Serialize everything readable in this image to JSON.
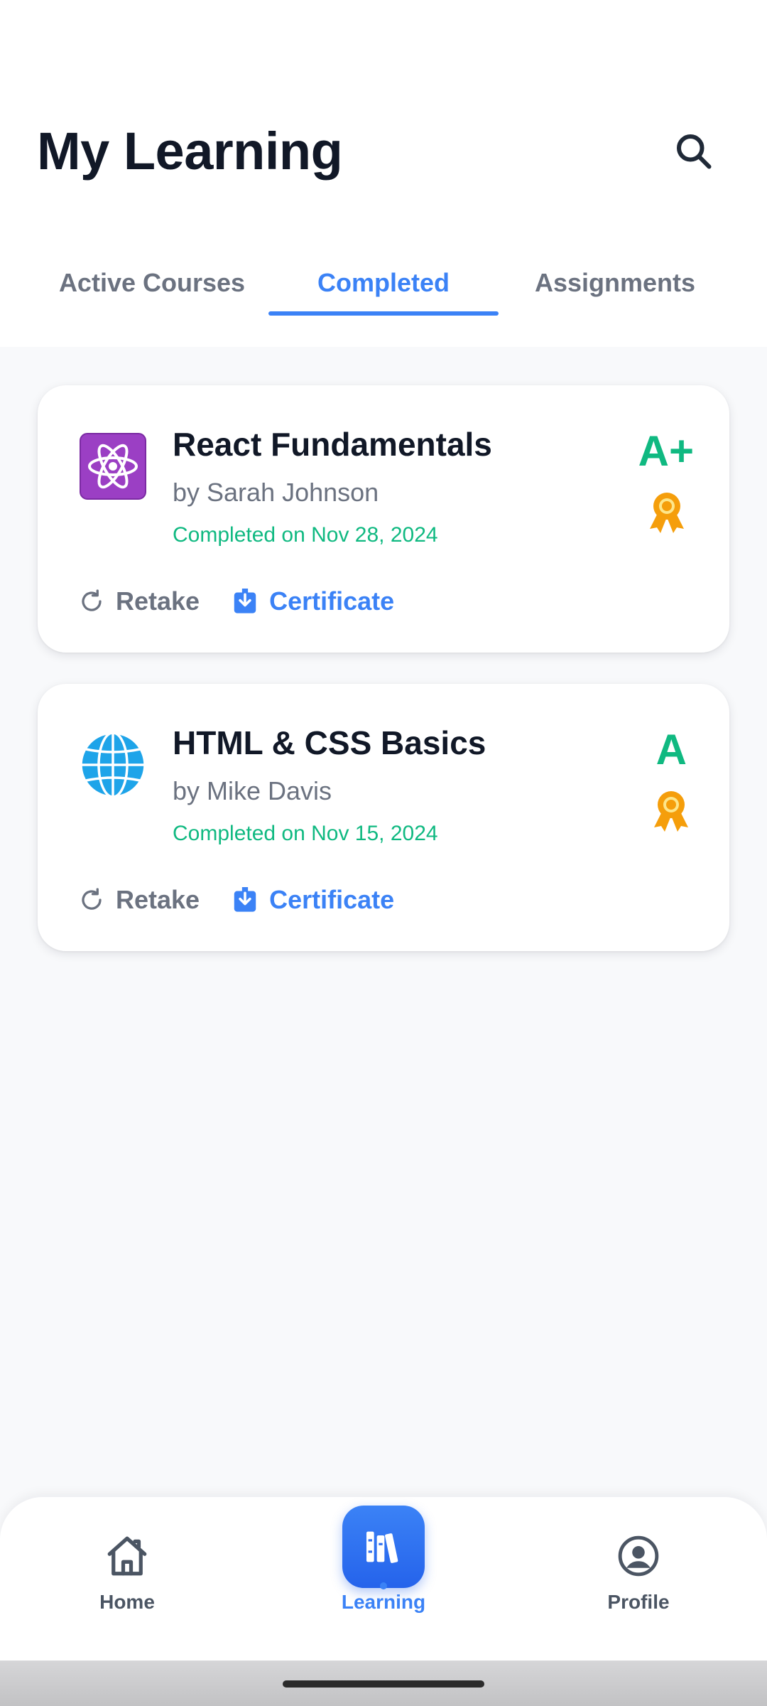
{
  "header": {
    "title": "My Learning"
  },
  "tabs": [
    {
      "label": "Active Courses",
      "active": false
    },
    {
      "label": "Completed",
      "active": true
    },
    {
      "label": "Assignments",
      "active": false
    }
  ],
  "courses": [
    {
      "icon": "atom-icon",
      "title": "React Fundamentals",
      "author": "by Sarah Johnson",
      "completed": "Completed on Nov 28, 2024",
      "grade": "A+",
      "retake_label": "Retake",
      "certificate_label": "Certificate"
    },
    {
      "icon": "globe-icon",
      "title": "HTML & CSS Basics",
      "author": "by Mike Davis",
      "completed": "Completed on Nov 15, 2024",
      "grade": "A",
      "retake_label": "Retake",
      "certificate_label": "Certificate"
    }
  ],
  "bottom_nav": {
    "items": [
      {
        "label": "Home",
        "icon": "home-icon",
        "active": false
      },
      {
        "label": "Learning",
        "icon": "books-icon",
        "active": true
      },
      {
        "label": "Profile",
        "icon": "user-circle-icon",
        "active": false
      }
    ]
  },
  "colors": {
    "accent": "#3b82f6",
    "success": "#10b981",
    "award": "#f59e0b",
    "text_primary": "#111827",
    "text_secondary": "#6b7280"
  }
}
